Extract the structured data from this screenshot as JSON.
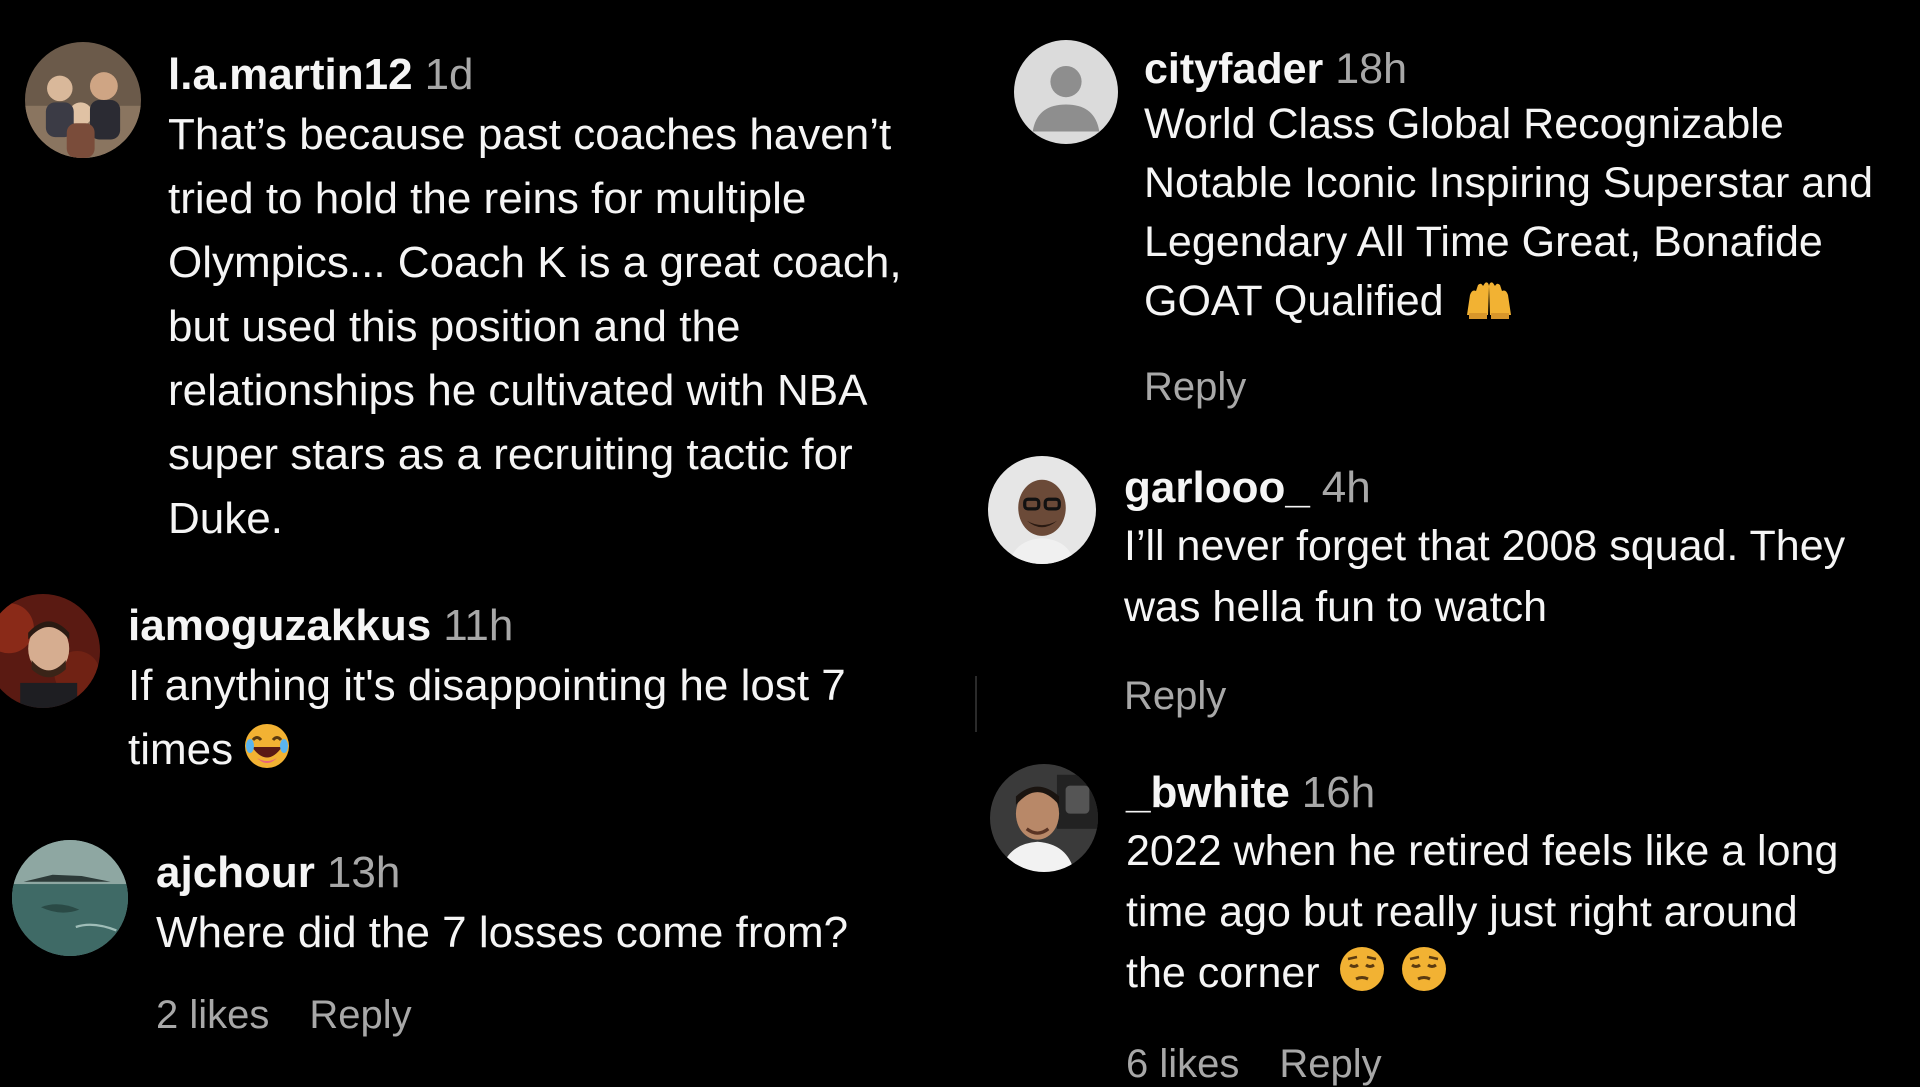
{
  "comments_left": [
    {
      "username": "l.a.martin12",
      "time": "1d",
      "text_lines": [
        "That’s because past coaches haven’t",
        "tried to hold the reins for multiple",
        "Olympics... Coach K is a great coach,",
        "but used this position and the",
        "relationships he cultivated with NBA",
        "super stars as a recruiting tactic for",
        "Duke."
      ]
    },
    {
      "username": "iamoguzakkus",
      "time": "11h",
      "text_lines": [
        "If anything it's disappointing he lost 7",
        "times"
      ],
      "emoji": "laughing-emoji"
    },
    {
      "username": "ajchour",
      "time": "13h",
      "text_lines": [
        "Where did the 7 losses come from?"
      ],
      "likes": "2 likes",
      "reply": "Reply"
    }
  ],
  "comments_right": [
    {
      "username": "cityfader",
      "time": "18h",
      "text_lines": [
        "World Class Global Recognizable",
        "Notable Iconic Inspiring Superstar and",
        "Legendary All Time Great, Bonafide",
        "GOAT Qualified"
      ],
      "emoji": "raised-hands-emoji",
      "reply": "Reply"
    },
    {
      "username": "garlooo_",
      "time": "4h",
      "text_lines": [
        "I’ll never forget that 2008 squad. They",
        "was hella fun to watch"
      ],
      "reply": "Reply"
    },
    {
      "username": "_bwhite",
      "time": "16h",
      "text_lines": [
        "2022 when he retired feels like a long",
        "time ago but really just right around",
        "the corner"
      ],
      "emoji": "pensive-face-emoji",
      "likes": "6 likes",
      "reply": "Reply"
    }
  ],
  "colors": {
    "background": "#000000",
    "primary_text": "#f5f5f5",
    "secondary_text": "#a8a8a8"
  }
}
